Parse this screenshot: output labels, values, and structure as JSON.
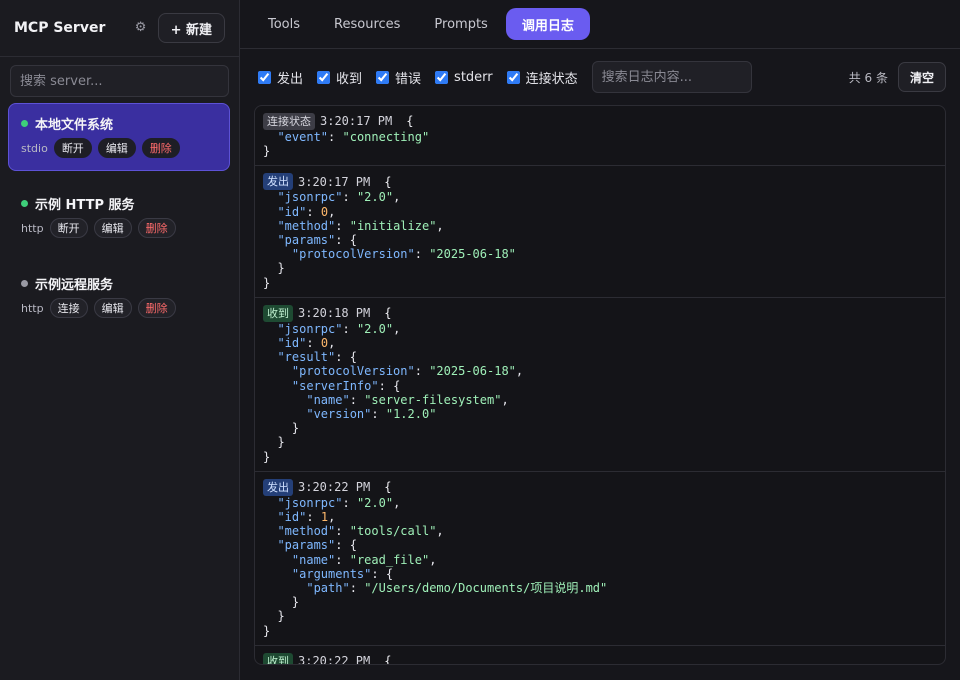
{
  "sidebar": {
    "title": "MCP Server",
    "gear_icon": "gear-icon",
    "new_button": "+ 新建",
    "search_placeholder": "搜索 server...",
    "servers": [
      {
        "name": "本地文件系统",
        "status": "connected",
        "type": "stdio",
        "toggle": "断开",
        "edit": "编辑",
        "delete": "删除"
      },
      {
        "name": "示例 HTTP 服务",
        "status": "connected",
        "type": "http",
        "toggle": "断开",
        "edit": "编辑",
        "delete": "删除"
      },
      {
        "name": "示例远程服务",
        "status": "disconnected",
        "type": "http",
        "toggle": "连接",
        "edit": "编辑",
        "delete": "删除"
      }
    ]
  },
  "tabs": [
    "Tools",
    "Resources",
    "Prompts",
    "调用日志"
  ],
  "active_tab": "调用日志",
  "filters": [
    {
      "label": "发出",
      "checked": true
    },
    {
      "label": "收到",
      "checked": true
    },
    {
      "label": "错误",
      "checked": true
    },
    {
      "label": "stderr",
      "checked": true
    },
    {
      "label": "连接状态",
      "checked": true
    }
  ],
  "log_search_placeholder": "搜索日志内容...",
  "count_label": "共 6 条",
  "clear_button": "清空",
  "colors": {
    "accent": "#6a5cf0",
    "active_server": "#3a2fa0",
    "connected": "#3ecf7a",
    "danger": "#ff6b6b"
  },
  "logs": [
    {
      "badge": "连接状态",
      "kind": "state",
      "time": "3:20:17 PM",
      "lines": [
        "  \"event\": \"connecting\"",
        "}"
      ]
    },
    {
      "badge": "发出",
      "kind": "out",
      "time": "3:20:17 PM",
      "lines": [
        "  \"jsonrpc\": \"2.0\",",
        "  \"id\": 0,",
        "  \"method\": \"initialize\",",
        "  \"params\": {",
        "    \"protocolVersion\": \"2025-06-18\"",
        "  }",
        "}"
      ]
    },
    {
      "badge": "收到",
      "kind": "in",
      "time": "3:20:18 PM",
      "lines": [
        "  \"jsonrpc\": \"2.0\",",
        "  \"id\": 0,",
        "  \"result\": {",
        "    \"protocolVersion\": \"2025-06-18\",",
        "    \"serverInfo\": {",
        "      \"name\": \"server-filesystem\",",
        "      \"version\": \"1.2.0\"",
        "    }",
        "  }",
        "}"
      ]
    },
    {
      "badge": "发出",
      "kind": "out",
      "time": "3:20:22 PM",
      "lines": [
        "  \"jsonrpc\": \"2.0\",",
        "  \"id\": 1,",
        "  \"method\": \"tools/call\",",
        "  \"params\": {",
        "    \"name\": \"read_file\",",
        "    \"arguments\": {",
        "      \"path\": \"/Users/demo/Documents/项目说明.md\"",
        "    }",
        "  }",
        "}"
      ]
    },
    {
      "badge": "收到",
      "kind": "in",
      "time": "3:20:22 PM",
      "lines": []
    }
  ]
}
